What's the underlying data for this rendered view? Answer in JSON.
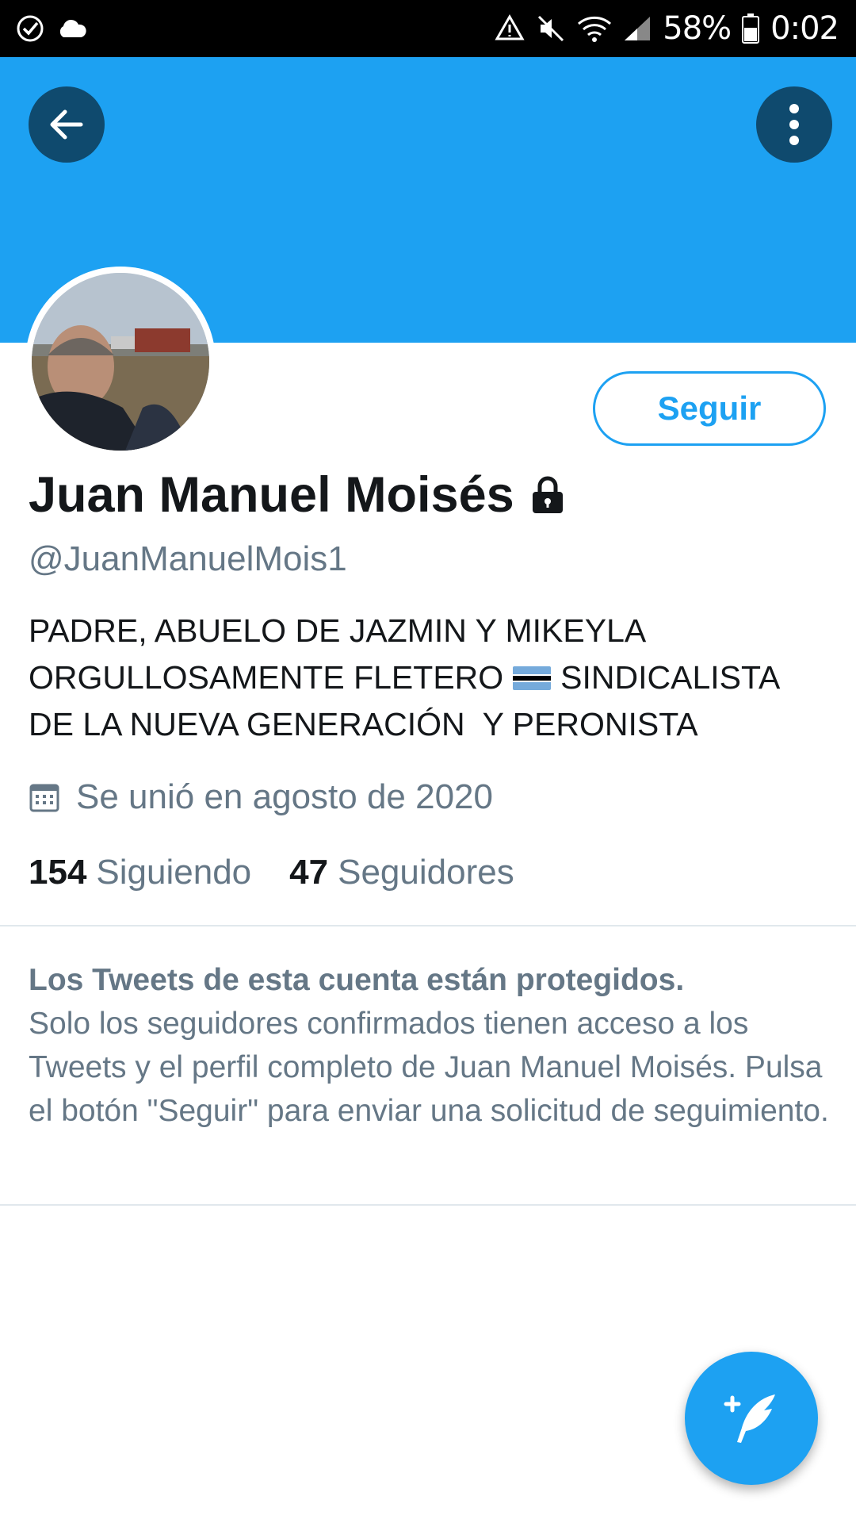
{
  "status_bar": {
    "battery": "58%",
    "time": "0:02"
  },
  "profile": {
    "name": "Juan Manuel Moisés",
    "handle": "@JuanManuelMois1",
    "follow_label": "Seguir",
    "bio_lines": [
      "PADRE, ABUELO DE JAZMIN Y MIKEYLA",
      "ORGULLOSAMENTE FLETERO",
      "SINDICALISTA",
      "DE LA NUEVA GENERACIÓN  Y PERONISTA"
    ],
    "joined": "Se unió en agosto de 2020",
    "following_count": "154",
    "following_label": "Siguiendo",
    "followers_count": "47",
    "followers_label": "Seguidores"
  },
  "protected_notice": {
    "title": "Los Tweets de esta cuenta están protegidos.",
    "body": "Solo los seguidores confirmados tienen acceso a los Tweets y el perfil completo de Juan Manuel Moisés. Pulsa el botón \"Seguir\" para enviar una solicitud de seguimiento."
  },
  "icons": {
    "back": "arrow-left-icon",
    "more": "more-vertical-icon",
    "lock": "lock-icon",
    "calendar": "calendar-icon",
    "compose": "compose-tweet-icon"
  },
  "colors": {
    "brand": "#1da1f2",
    "header_button": "#0f4a6e",
    "secondary_text": "#657786"
  }
}
